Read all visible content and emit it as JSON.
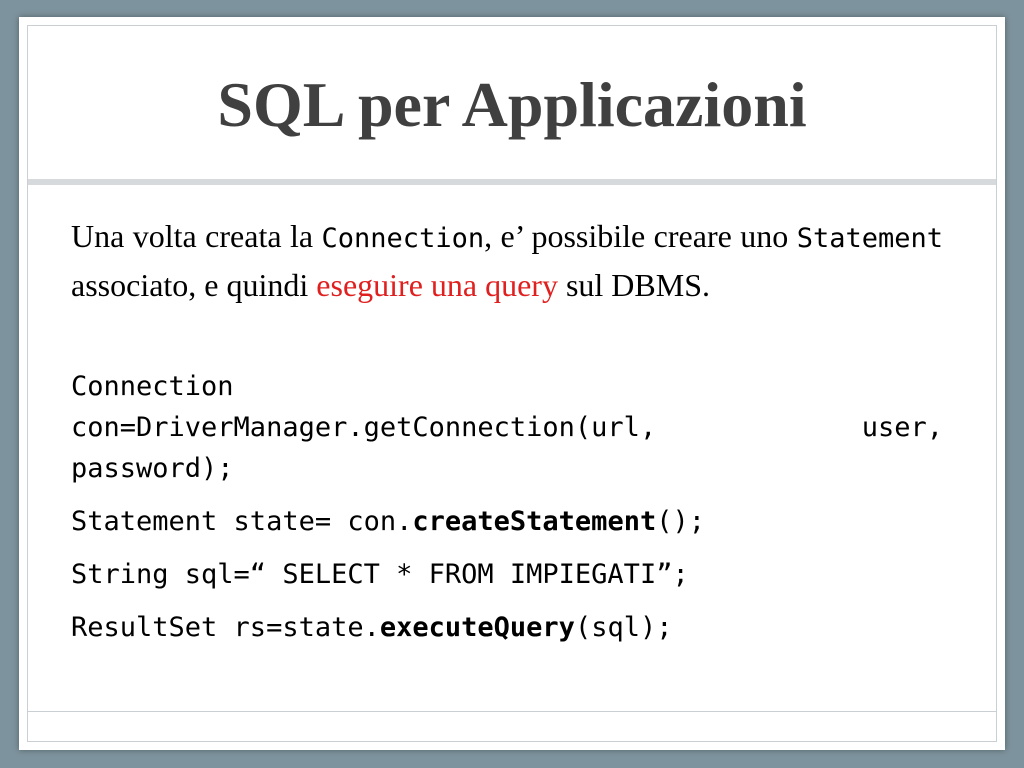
{
  "slide": {
    "title": "SQL per Applicazioni",
    "paragraph": {
      "part1": "Una volta creata la ",
      "code1": "Connection",
      "part2": ", e’ possibile creare uno ",
      "code2": "Statement",
      "part3": " associato, e quindi ",
      "highlight": "eseguire una query",
      "part4": " sul DBMS."
    },
    "code": {
      "line1": "Connection",
      "line2_a": "con=DriverManager.getConnection(url,",
      "line2_b": "user,",
      "line3": "password);",
      "line4_pre": "Statement state= con.",
      "line4_bold": "createStatement",
      "line4_post": "();",
      "line5": "String sql=“ SELECT * FROM IMPIEGATI”;",
      "line6_pre": "ResultSet rs=state.",
      "line6_bold": "executeQuery",
      "line6_post": "(sql);"
    }
  },
  "colors": {
    "background": "#7d939d",
    "title": "#404040",
    "highlight": "#e01f1f"
  }
}
